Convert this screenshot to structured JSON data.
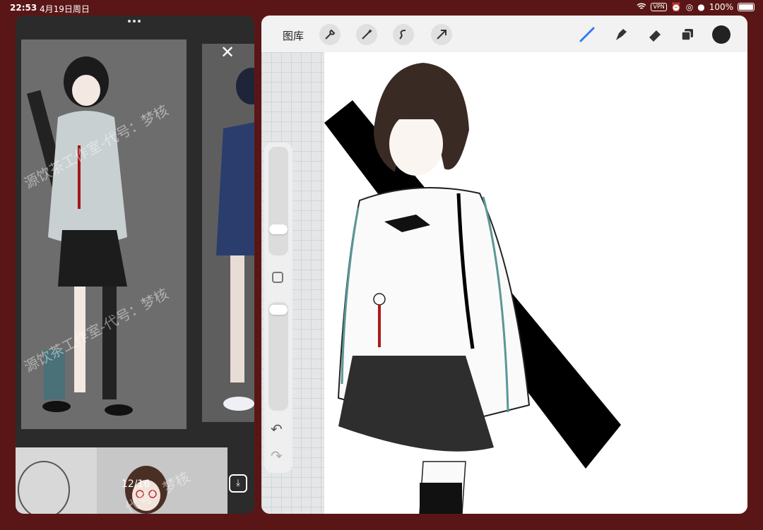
{
  "status_bar": {
    "time": "22:53",
    "date": "4月19日周日",
    "vpn": "VPN",
    "battery": "100%"
  },
  "viewer": {
    "counter": "12/16",
    "watermark_1": "源饮茶工作室-代号：梦核",
    "watermark_2": "源饮茶工作室-代号：梦核",
    "watermark_3": "代号：梦核"
  },
  "procreate": {
    "gallery_label": "图库",
    "tools_left": [
      "wrench-icon",
      "magic-wand-icon",
      "selection-icon",
      "transform-icon"
    ],
    "tools_right": [
      "brush-icon",
      "smudge-icon",
      "eraser-icon",
      "layers-icon",
      "color-icon"
    ],
    "active_color": "#222222",
    "brush_accent": "#2f7bf6"
  }
}
